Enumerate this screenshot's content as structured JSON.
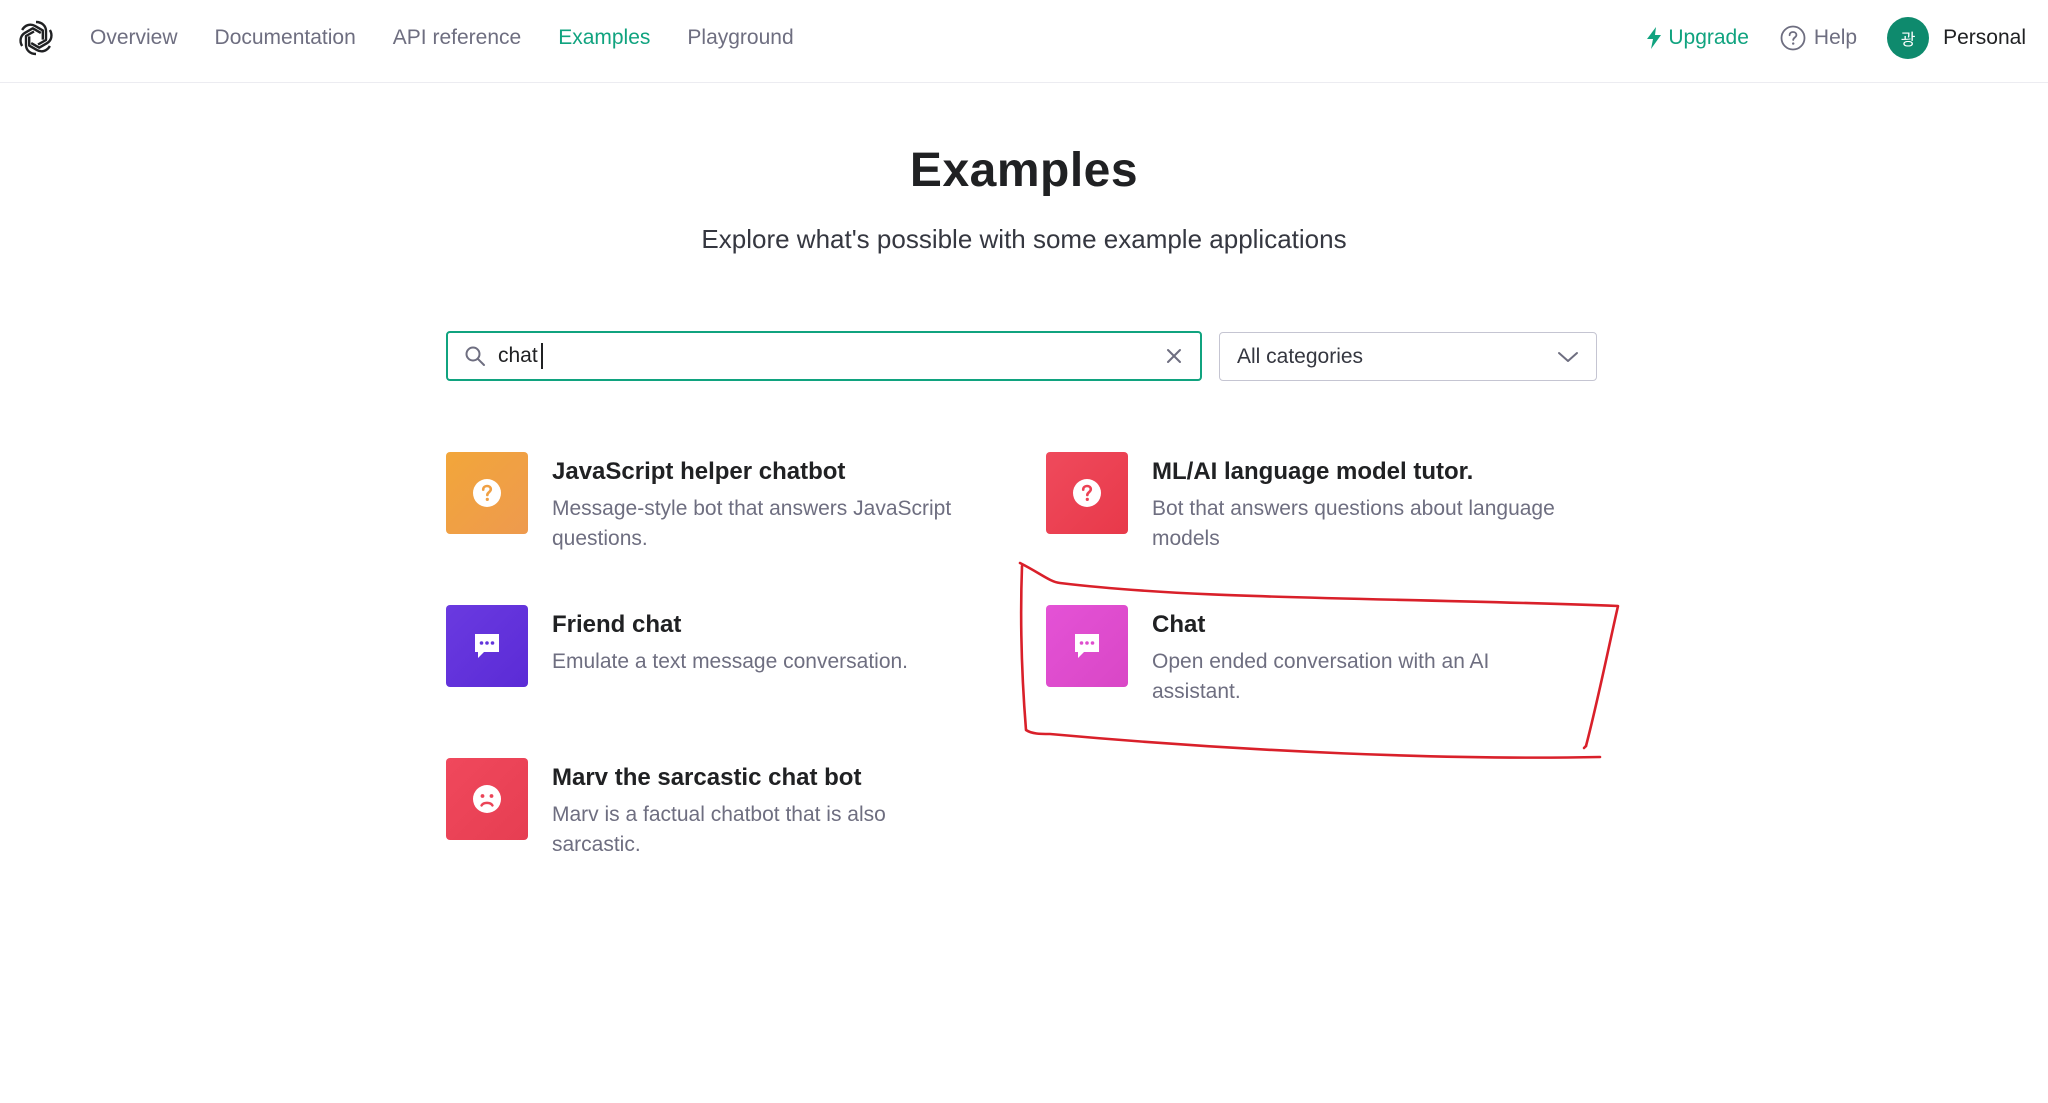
{
  "nav": {
    "links": [
      {
        "label": "Overview"
      },
      {
        "label": "Documentation"
      },
      {
        "label": "API reference"
      },
      {
        "label": "Examples",
        "active": true
      },
      {
        "label": "Playground"
      }
    ],
    "upgrade_label": "Upgrade",
    "help_label": "Help",
    "account": {
      "avatar_text": "광",
      "label": "Personal"
    }
  },
  "header": {
    "title": "Examples",
    "subtitle": "Explore what's possible with some example applications"
  },
  "search": {
    "value": "chat",
    "placeholder": ""
  },
  "filter": {
    "selected": "All categories"
  },
  "examples": [
    {
      "title": "JavaScript helper chatbot",
      "description_line1": "Message-style bot that answers JavaScript",
      "description_line2": "questions.",
      "icon": "question-icon",
      "color": "#f2a63a"
    },
    {
      "title": "ML/AI language model tutor.",
      "description_line1": "Bot that answers questions about language",
      "description_line2": "models",
      "icon": "question-icon",
      "color": "#ef4a5c"
    },
    {
      "title": "Friend chat",
      "description_line1": "Emulate a text message conversation.",
      "description_line2": "",
      "icon": "chat-bubble-icon",
      "color": "#6a3ae0"
    },
    {
      "title": "Chat",
      "description_line1": "Open ended conversation with an AI",
      "description_line2": "assistant.",
      "icon": "chat-bubble-icon",
      "color": "#e452d6"
    },
    {
      "title": "Marv the sarcastic chat bot",
      "description_line1": "Marv is a factual chatbot that is also",
      "description_line2": "sarcastic.",
      "icon": "frown-face-icon",
      "color": "#f0485c"
    }
  ],
  "colors": {
    "accent": "#10a37f",
    "annotation": "#d9202a"
  }
}
